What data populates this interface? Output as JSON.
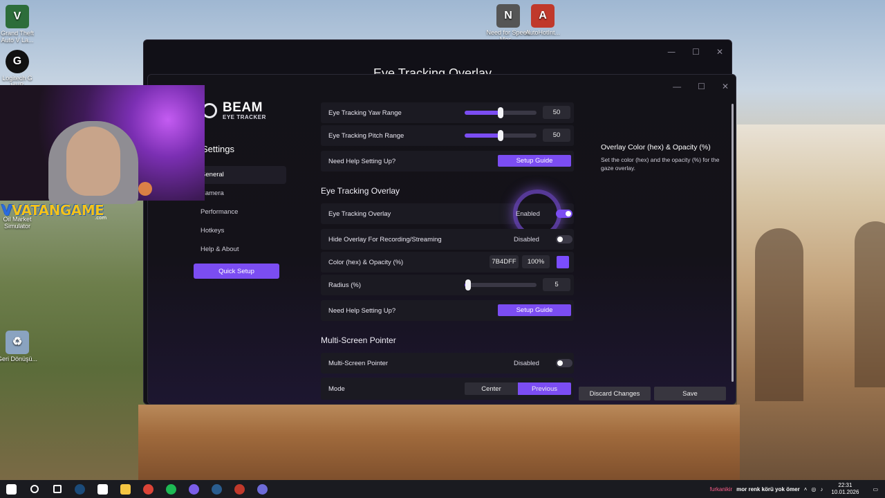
{
  "desktop": {
    "icons": [
      {
        "label": "Grand Theft Auto V La...",
        "color": "#2d6d3a",
        "glyph": "V"
      },
      {
        "label": "Logitech G HUB",
        "color": "#111111",
        "glyph": "G"
      },
      {
        "label": "Oil Market Simulator",
        "color": "#b58a2a",
        "glyph": "O"
      },
      {
        "label": "Geri Dönüşü...",
        "color": "#8aa3c0",
        "glyph": "♻"
      },
      {
        "label": "Need for Speed Mos...",
        "color": "#555555",
        "glyph": "N"
      },
      {
        "label": "AutoHotInt...",
        "color": "#c0392b",
        "glyph": "A"
      }
    ]
  },
  "background_window": {
    "title": "Eye Tracking Overlay"
  },
  "window": {
    "controls": {
      "minimize": "—",
      "maximize": "☐",
      "close": "✕"
    },
    "brand": {
      "name": "BEAM",
      "sub": "EYE TRACKER"
    },
    "settings_heading": "Settings",
    "nav": [
      {
        "label": "General",
        "active": true
      },
      {
        "label": "Camera",
        "active": false
      },
      {
        "label": "Performance",
        "active": false
      },
      {
        "label": "Hotkeys",
        "active": false
      },
      {
        "label": "Help & About",
        "active": false
      }
    ],
    "quick_setup": "Quick Setup",
    "rows": {
      "yaw": {
        "label": "Eye Tracking Yaw Range",
        "value": "50",
        "level": 0.5
      },
      "pitch": {
        "label": "Eye Tracking Pitch Range",
        "value": "50",
        "level": 0.5
      },
      "help1": {
        "label": "Need Help Setting Up?",
        "button": "Setup Guide"
      },
      "overlay": {
        "label": "Eye Tracking Overlay",
        "status": "Enabled",
        "on": true
      },
      "hide": {
        "label": "Hide Overlay For Recording/Streaming",
        "status": "Disabled",
        "on": false
      },
      "color": {
        "label": "Color (hex) & Opacity (%)",
        "hex": "7B4DFF",
        "opacity": "100%",
        "swatch": "#7B4DFF"
      },
      "radius": {
        "label": "Radius (%)",
        "value": "5",
        "level": 0.05
      },
      "help2": {
        "label": "Need Help Setting Up?",
        "button": "Setup Guide"
      },
      "multi": {
        "label": "Multi-Screen Pointer",
        "status": "Disabled",
        "on": false
      },
      "mode": {
        "label": "Mode",
        "options": [
          "Center",
          "Previous"
        ],
        "selected": "Previous"
      }
    },
    "sections": {
      "overlay": "Eye Tracking Overlay",
      "multi": "Multi-Screen Pointer"
    },
    "help_panel": {
      "title": "Overlay Color (hex) & Opacity (%)",
      "text": "Set the color (hex) and the opacity (%) for the gaze overlay."
    },
    "footer": {
      "discard": "Discard Changes",
      "save": "Save"
    }
  },
  "webcam": {
    "logo_v": "V",
    "logo_text": "VATANGAME",
    "logo_com": ".com"
  },
  "taskbar": {
    "icons": [
      {
        "name": "windows-start-icon",
        "color": "#ffffff"
      },
      {
        "name": "search-icon",
        "color": "#ffffff"
      },
      {
        "name": "task-view-icon",
        "color": "#ffffff"
      },
      {
        "name": "steam-icon",
        "color": "#1b4b7a"
      },
      {
        "name": "store-icon",
        "color": "#ffffff"
      },
      {
        "name": "file-explorer-icon",
        "color": "#f4c542"
      },
      {
        "name": "chrome-icon",
        "color": "#db4437"
      },
      {
        "name": "spotify-icon",
        "color": "#1db954"
      },
      {
        "name": "discord-icon",
        "color": "#7b5ee8"
      },
      {
        "name": "steam-2-icon",
        "color": "#2a5d8f"
      },
      {
        "name": "app-icon",
        "color": "#c0392b"
      },
      {
        "name": "beam-icon",
        "color": "#6d6bd8"
      }
    ],
    "chat_user": "furkanikir",
    "chat_message": "mor renk körü yok ömer",
    "time": "22:31",
    "date": "10.01.2026"
  }
}
